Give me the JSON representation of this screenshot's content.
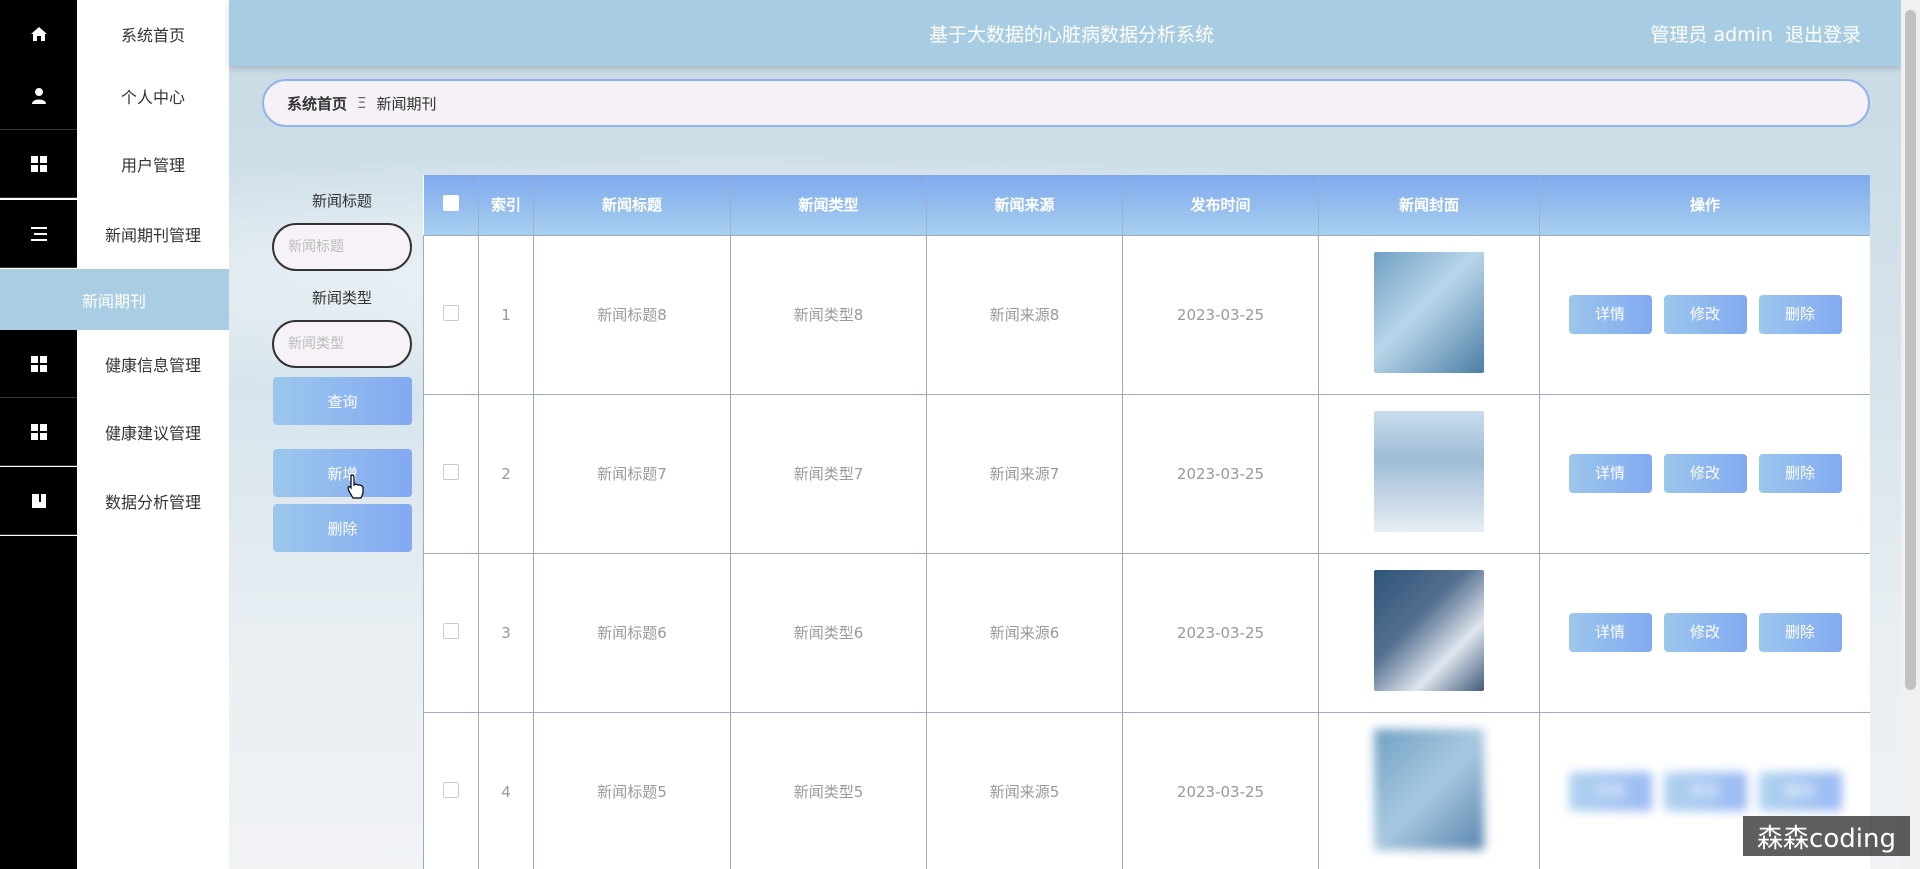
{
  "header": {
    "title": "基于大数据的心脏病数据分析系统",
    "admin_label": "管理员 admin",
    "logout_label": "退出登录"
  },
  "sidebar": {
    "items": [
      {
        "label": "系统首页",
        "icon": "home-icon"
      },
      {
        "label": "个人中心",
        "icon": "user-icon"
      },
      {
        "label": "用户管理",
        "icon": "grid-icon"
      },
      {
        "label": "新闻期刊管理",
        "icon": "list-icon"
      },
      {
        "label": "健康信息管理",
        "icon": "grid-icon"
      },
      {
        "label": "健康建议管理",
        "icon": "grid-icon"
      },
      {
        "label": "数据分析管理",
        "icon": "book-icon"
      }
    ],
    "sub_item": "新闻期刊"
  },
  "breadcrumb": {
    "home": "系统首页",
    "separator": "Ξ",
    "current": "新闻期刊"
  },
  "search": {
    "title_label": "新闻标题",
    "title_placeholder": "新闻标题",
    "type_label": "新闻类型",
    "type_placeholder": "新闻类型",
    "query_button": "查询",
    "add_button": "新增",
    "delete_button": "删除"
  },
  "table": {
    "headers": [
      "索引",
      "新闻标题",
      "新闻类型",
      "新闻来源",
      "发布时间",
      "新闻封面",
      "操作"
    ],
    "rows": [
      {
        "index": "1",
        "title": "新闻标题8",
        "type": "新闻类型8",
        "source": "新闻来源8",
        "date": "2023-03-25"
      },
      {
        "index": "2",
        "title": "新闻标题7",
        "type": "新闻类型7",
        "source": "新闻来源7",
        "date": "2023-03-25"
      },
      {
        "index": "3",
        "title": "新闻标题6",
        "type": "新闻类型6",
        "source": "新闻来源6",
        "date": "2023-03-25"
      },
      {
        "index": "4",
        "title": "新闻标题5",
        "type": "新闻类型5",
        "source": "新闻来源5",
        "date": "2023-03-25"
      }
    ],
    "actions": {
      "detail": "详情",
      "edit": "修改",
      "delete": "删除"
    }
  },
  "watermark": "森森coding",
  "colors": {
    "header_bg": "#a8cde3",
    "button_gradient_start": "#9cc7ec",
    "button_gradient_end": "#82a9f2",
    "sidebar_icon_bg": "#000000"
  }
}
